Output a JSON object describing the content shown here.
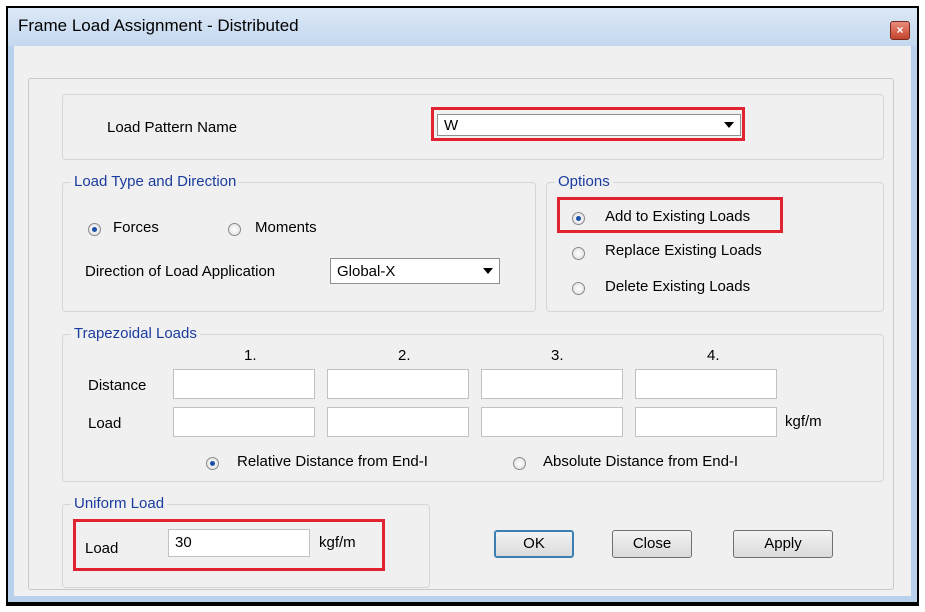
{
  "window": {
    "title": "Frame Load Assignment - Distributed",
    "close_glyph": "×"
  },
  "load_pattern": {
    "label": "Load Pattern Name",
    "value": "W"
  },
  "load_type": {
    "title": "Load Type and Direction",
    "forces": "Forces",
    "moments": "Moments",
    "direction_label": "Direction of Load Application",
    "direction_value": "Global-X",
    "selected": "Forces"
  },
  "options": {
    "title": "Options",
    "add": "Add to Existing Loads",
    "replace": "Replace Existing Loads",
    "delete": "Delete Existing Loads",
    "selected": "Add to Existing Loads"
  },
  "trapezoidal": {
    "title": "Trapezoidal Loads",
    "columns": [
      "1.",
      "2.",
      "3.",
      "4."
    ],
    "distance_label": "Distance",
    "load_label": "Load",
    "unit": "kgf/m",
    "relative": "Relative Distance from End-I",
    "absolute": "Absolute Distance from End-I",
    "selected": "Relative Distance from End-I"
  },
  "uniform": {
    "title": "Uniform Load",
    "load_label": "Load",
    "value": "30",
    "unit": "kgf/m"
  },
  "buttons": {
    "ok": "OK",
    "close": "Close",
    "apply": "Apply"
  },
  "colors": {
    "highlight": "#e0232e",
    "group_title": "#1a3c9e"
  }
}
